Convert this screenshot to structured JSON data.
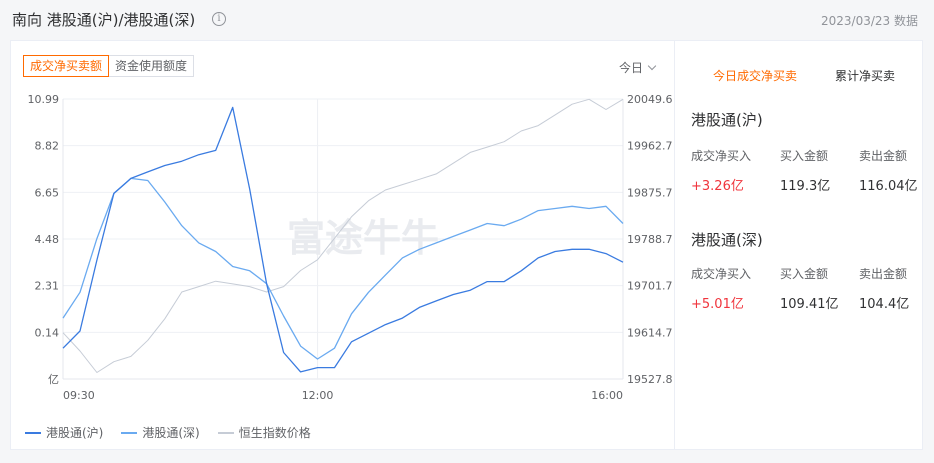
{
  "header": {
    "title": "南向 港股通(沪)/港股通(深)",
    "date": "2023/03/23",
    "date_suffix": "数据"
  },
  "tabs": [
    "成交净买卖额",
    "资金使用额度"
  ],
  "period": "今日",
  "right_panel": {
    "tabs": [
      "今日成交净买卖",
      "累计净买卖"
    ],
    "sections": [
      {
        "title": "港股通(沪)",
        "labels": [
          "成交净买入",
          "买入金额",
          "卖出金额"
        ],
        "values": [
          "+3.26亿",
          "119.3亿",
          "116.04亿"
        ]
      },
      {
        "title": "港股通(深)",
        "labels": [
          "成交净买入",
          "买入金额",
          "卖出金额"
        ],
        "values": [
          "+5.01亿",
          "109.41亿",
          "104.4亿"
        ]
      }
    ]
  },
  "colors": {
    "accent": "#ff6a00",
    "sh": "#3a7be0",
    "sz": "#6aaaf0",
    "hsi": "#c6ccd6",
    "up": "#f0343c"
  },
  "watermark": "富途牛牛",
  "chart_data": {
    "type": "line",
    "left_axis": {
      "ticks": [
        "10.99",
        "8.82",
        "6.65",
        "4.48",
        "2.31",
        "0.14"
      ],
      "unit": "亿",
      "range": [
        -2.03,
        10.99
      ]
    },
    "right_axis": {
      "ticks": [
        "20049.6",
        "19962.7",
        "19875.7",
        "19788.7",
        "19701.7",
        "19614.7",
        "19527.8"
      ],
      "range": [
        19527.8,
        20049.6
      ]
    },
    "x_ticks": [
      "09:30",
      "12:00",
      "16:00"
    ],
    "x_range": [
      0,
      330
    ],
    "series": [
      {
        "name": "港股通(沪)",
        "axis": "left",
        "x": [
          0,
          10,
          20,
          30,
          40,
          50,
          60,
          70,
          80,
          90,
          100,
          110,
          120,
          130,
          140,
          150,
          160,
          170,
          180,
          190,
          200,
          210,
          220,
          230,
          240,
          250,
          260,
          270,
          280,
          290,
          300,
          310,
          320,
          330
        ],
        "values": [
          -0.6,
          0.2,
          3.5,
          6.6,
          7.3,
          7.6,
          7.9,
          8.1,
          8.4,
          8.6,
          10.6,
          6.8,
          2.4,
          -0.8,
          -1.7,
          -1.5,
          -1.5,
          -0.3,
          0.1,
          0.5,
          0.8,
          1.3,
          1.6,
          1.9,
          2.1,
          2.5,
          2.5,
          3.0,
          3.6,
          3.9,
          4.0,
          4.0,
          3.8,
          3.4
        ]
      },
      {
        "name": "港股通(深)",
        "axis": "left",
        "x": [
          0,
          10,
          20,
          30,
          40,
          50,
          60,
          70,
          80,
          90,
          100,
          110,
          120,
          130,
          140,
          150,
          160,
          170,
          180,
          190,
          200,
          210,
          220,
          230,
          240,
          250,
          260,
          270,
          280,
          290,
          300,
          310,
          320,
          330
        ],
        "values": [
          0.8,
          2.0,
          4.5,
          6.6,
          7.3,
          7.2,
          6.2,
          5.1,
          4.3,
          3.9,
          3.2,
          3.0,
          2.4,
          0.9,
          -0.5,
          -1.1,
          -0.6,
          1.0,
          2.0,
          2.8,
          3.6,
          4.0,
          4.3,
          4.6,
          4.9,
          5.2,
          5.1,
          5.4,
          5.8,
          5.9,
          6.0,
          5.9,
          6.0,
          5.2
        ]
      },
      {
        "name": "恒生指数价格",
        "axis": "right",
        "x": [
          0,
          10,
          20,
          30,
          40,
          50,
          60,
          70,
          80,
          90,
          100,
          110,
          120,
          130,
          140,
          150,
          160,
          170,
          180,
          190,
          200,
          210,
          220,
          230,
          240,
          250,
          260,
          270,
          280,
          290,
          300,
          310,
          320,
          330
        ],
        "values": [
          19614,
          19580,
          19540,
          19560,
          19570,
          19600,
          19640,
          19690,
          19700,
          19710,
          19705,
          19700,
          19690,
          19700,
          19730,
          19750,
          19790,
          19830,
          19860,
          19880,
          19890,
          19900,
          19910,
          19930,
          19950,
          19960,
          19970,
          19990,
          20000,
          20020,
          20040,
          20049,
          20030,
          20049
        ]
      }
    ]
  }
}
